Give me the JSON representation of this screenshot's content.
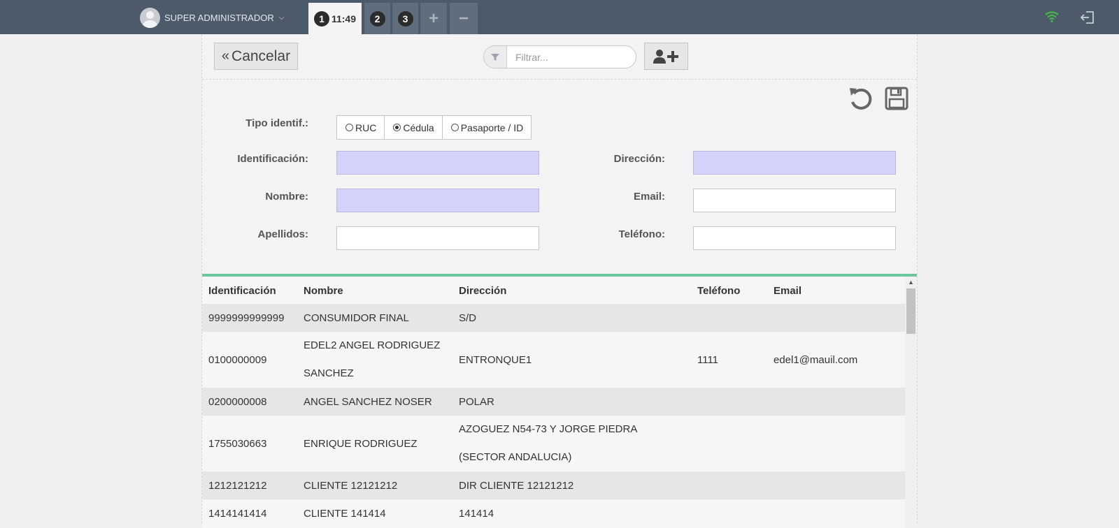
{
  "header": {
    "user_name": "SUPER ADMINISTRADOR",
    "tabs": [
      {
        "number": "1",
        "time": "11:49"
      },
      {
        "number": "2"
      },
      {
        "number": "3"
      }
    ],
    "add_tab": "+",
    "remove_tab": "−"
  },
  "toolbar": {
    "cancel_label": "Cancelar",
    "filter_placeholder": "Filtrar..."
  },
  "form": {
    "tipo_label": "Tipo identif.:",
    "tipo_options": [
      "RUC",
      "Cédula",
      "Pasaporte / ID"
    ],
    "tipo_selected": "Cédula",
    "identificacion_label": "Identificación:",
    "identificacion_value": "",
    "nombre_label": "Nombre:",
    "nombre_value": "",
    "apellidos_label": "Apellidos:",
    "apellidos_value": "",
    "direccion_label": "Dirección:",
    "direccion_value": "",
    "email_label": "Email:",
    "email_value": "",
    "telefono_label": "Teléfono:",
    "telefono_value": ""
  },
  "table": {
    "headers": [
      "Identificación",
      "Nombre",
      "Dirección",
      "Teléfono",
      "Email"
    ],
    "rows": [
      {
        "id": "9999999999999",
        "nombre": [
          "CONSUMIDOR FINAL"
        ],
        "direccion": [
          "S/D"
        ],
        "telefono": "",
        "email": ""
      },
      {
        "id": "0100000009",
        "nombre": [
          "EDEL2 ANGEL RODRIGUEZ",
          "SANCHEZ"
        ],
        "direccion": [
          "ENTRONQUE1"
        ],
        "telefono": "1111",
        "email": "edel1@mauil.com"
      },
      {
        "id": "0200000008",
        "nombre": [
          "ANGEL SANCHEZ NOSER"
        ],
        "direccion": [
          "POLAR"
        ],
        "telefono": "",
        "email": ""
      },
      {
        "id": "1755030663",
        "nombre": [
          "ENRIQUE RODRIGUEZ"
        ],
        "direccion": [
          "AZOGUEZ N54-73 Y JORGE PIEDRA",
          "(SECTOR ANDALUCIA)"
        ],
        "telefono": "",
        "email": ""
      },
      {
        "id": "1212121212",
        "nombre": [
          "CLIENTE 12121212"
        ],
        "direccion": [
          "DIR CLIENTE 12121212"
        ],
        "telefono": "",
        "email": ""
      },
      {
        "id": "1414141414",
        "nombre": [
          "CLIENTE 141414"
        ],
        "direccion": [
          "141414"
        ],
        "telefono": "",
        "email": ""
      }
    ]
  },
  "colors": {
    "topbar": "#4c5a69",
    "required_field": "#d2d2fb",
    "grid_accent": "#6cc89c",
    "wifi": "#4caf50"
  }
}
